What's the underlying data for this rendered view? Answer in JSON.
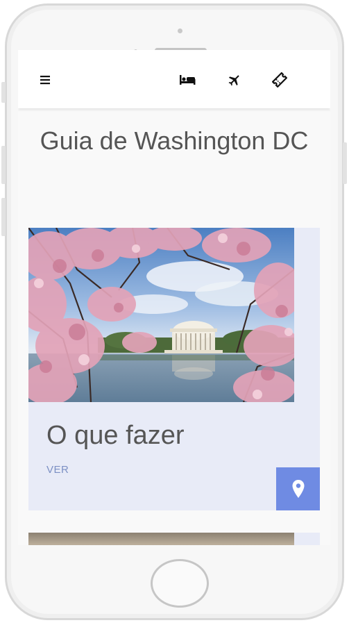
{
  "colors": {
    "card_background": "#e8ebf7",
    "accent": "#6f8be3",
    "link": "#7c90c4",
    "title_text": "#555555"
  },
  "appbar": {
    "icons": [
      "menu-icon",
      "hotel-bed-icon",
      "flight-icon",
      "ticket-icon"
    ]
  },
  "page": {
    "title": "Guia de Washington DC"
  },
  "cards": [
    {
      "title": "O que fazer",
      "link_label": "VER",
      "image": "cherry-blossoms-jefferson-memorial",
      "action_icon": "location-pin-icon"
    }
  ]
}
